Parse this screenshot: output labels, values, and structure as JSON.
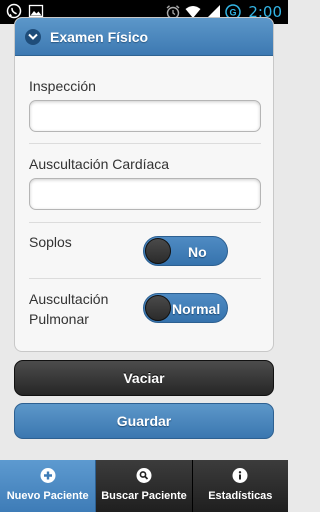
{
  "status_bar": {
    "time": "2:00",
    "left_icons": [
      "whatsapp-icon",
      "image-icon"
    ],
    "right_icons": [
      "alarm-icon",
      "wifi-icon",
      "signal-icon",
      "sync-icon"
    ]
  },
  "panel": {
    "title": "Examen Físico",
    "header_icon": "chevron-down-icon"
  },
  "form": {
    "inspeccion_label": "Inspección",
    "inspeccion_value": "",
    "auscultacion_cardiaca_label": "Auscultación Cardíaca",
    "auscultacion_cardiaca_value": "",
    "soplos_label": "Soplos",
    "soplos_value": "No",
    "auscultacion_pulmonar_label_line1": "Auscultación",
    "auscultacion_pulmonar_label_line2": "Pulmonar",
    "auscultacion_pulmonar_value": "Normal"
  },
  "actions": {
    "vaciar_label": "Vaciar",
    "guardar_label": "Guardar"
  },
  "navbar": {
    "items": [
      {
        "label": "Nuevo Paciente",
        "icon": "plus-icon",
        "active": true
      },
      {
        "label": "Buscar Paciente",
        "icon": "search-icon",
        "active": false
      },
      {
        "label": "Estadísticas",
        "icon": "info-icon",
        "active": false
      }
    ]
  },
  "colors": {
    "accent_blue": "#3d79b2",
    "dark_button": "#2b2b2b",
    "status_time": "#33b5e5"
  }
}
